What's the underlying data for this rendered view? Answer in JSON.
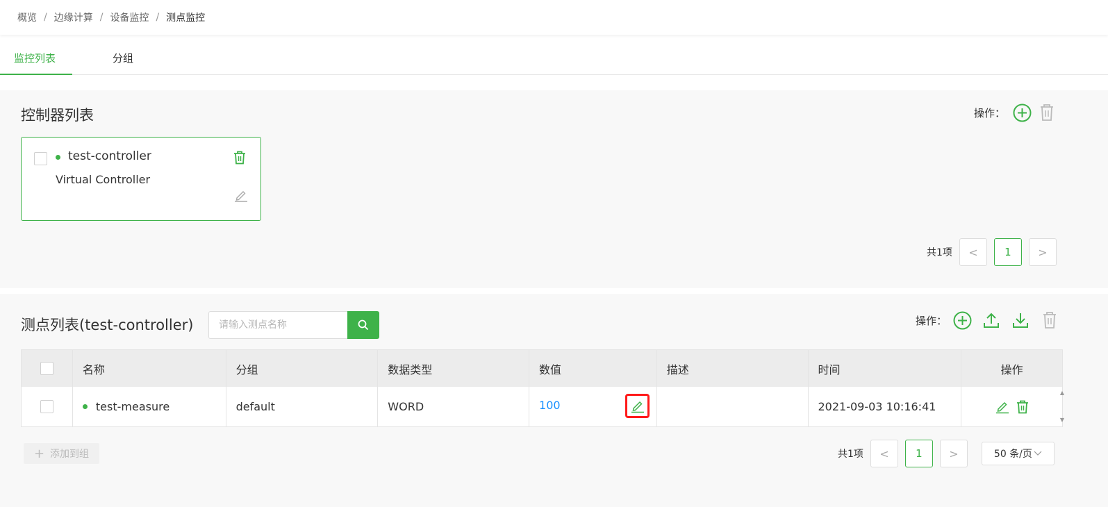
{
  "breadcrumb": {
    "items": [
      "概览",
      "边缘计算",
      "设备监控"
    ],
    "current": "测点监控",
    "separator": "/"
  },
  "tabs": [
    {
      "label": "监控列表",
      "active": true
    },
    {
      "label": "分组",
      "active": false
    }
  ],
  "controller_section": {
    "title": "控制器列表",
    "ops_label": "操作：",
    "controller": {
      "name": "test-controller",
      "description": "Virtual Controller",
      "status_color": "#3eb249"
    },
    "pagination": {
      "total_label": "共1项",
      "current_page": "1",
      "prev": "<",
      "next": ">"
    }
  },
  "measure_section": {
    "title": "测点列表(test-controller)",
    "search_placeholder": "请输入测点名称",
    "ops_label": "操作：",
    "table": {
      "headers": [
        "名称",
        "分组",
        "数据类型",
        "数值",
        "描述",
        "时间",
        "操作"
      ],
      "rows": [
        {
          "name": "test-measure",
          "group": "default",
          "data_type": "WORD",
          "value": "100",
          "description": "",
          "time": "2021-09-03 10:16:41"
        }
      ]
    },
    "add_group_label": "添加到组",
    "pagination": {
      "total_label": "共1项",
      "current_page": "1",
      "prev": "<",
      "next": ">",
      "page_size": "50 条/页"
    }
  },
  "colors": {
    "accent": "#3eb249",
    "link": "#1890ff",
    "highlight": "#ff1a1a"
  }
}
